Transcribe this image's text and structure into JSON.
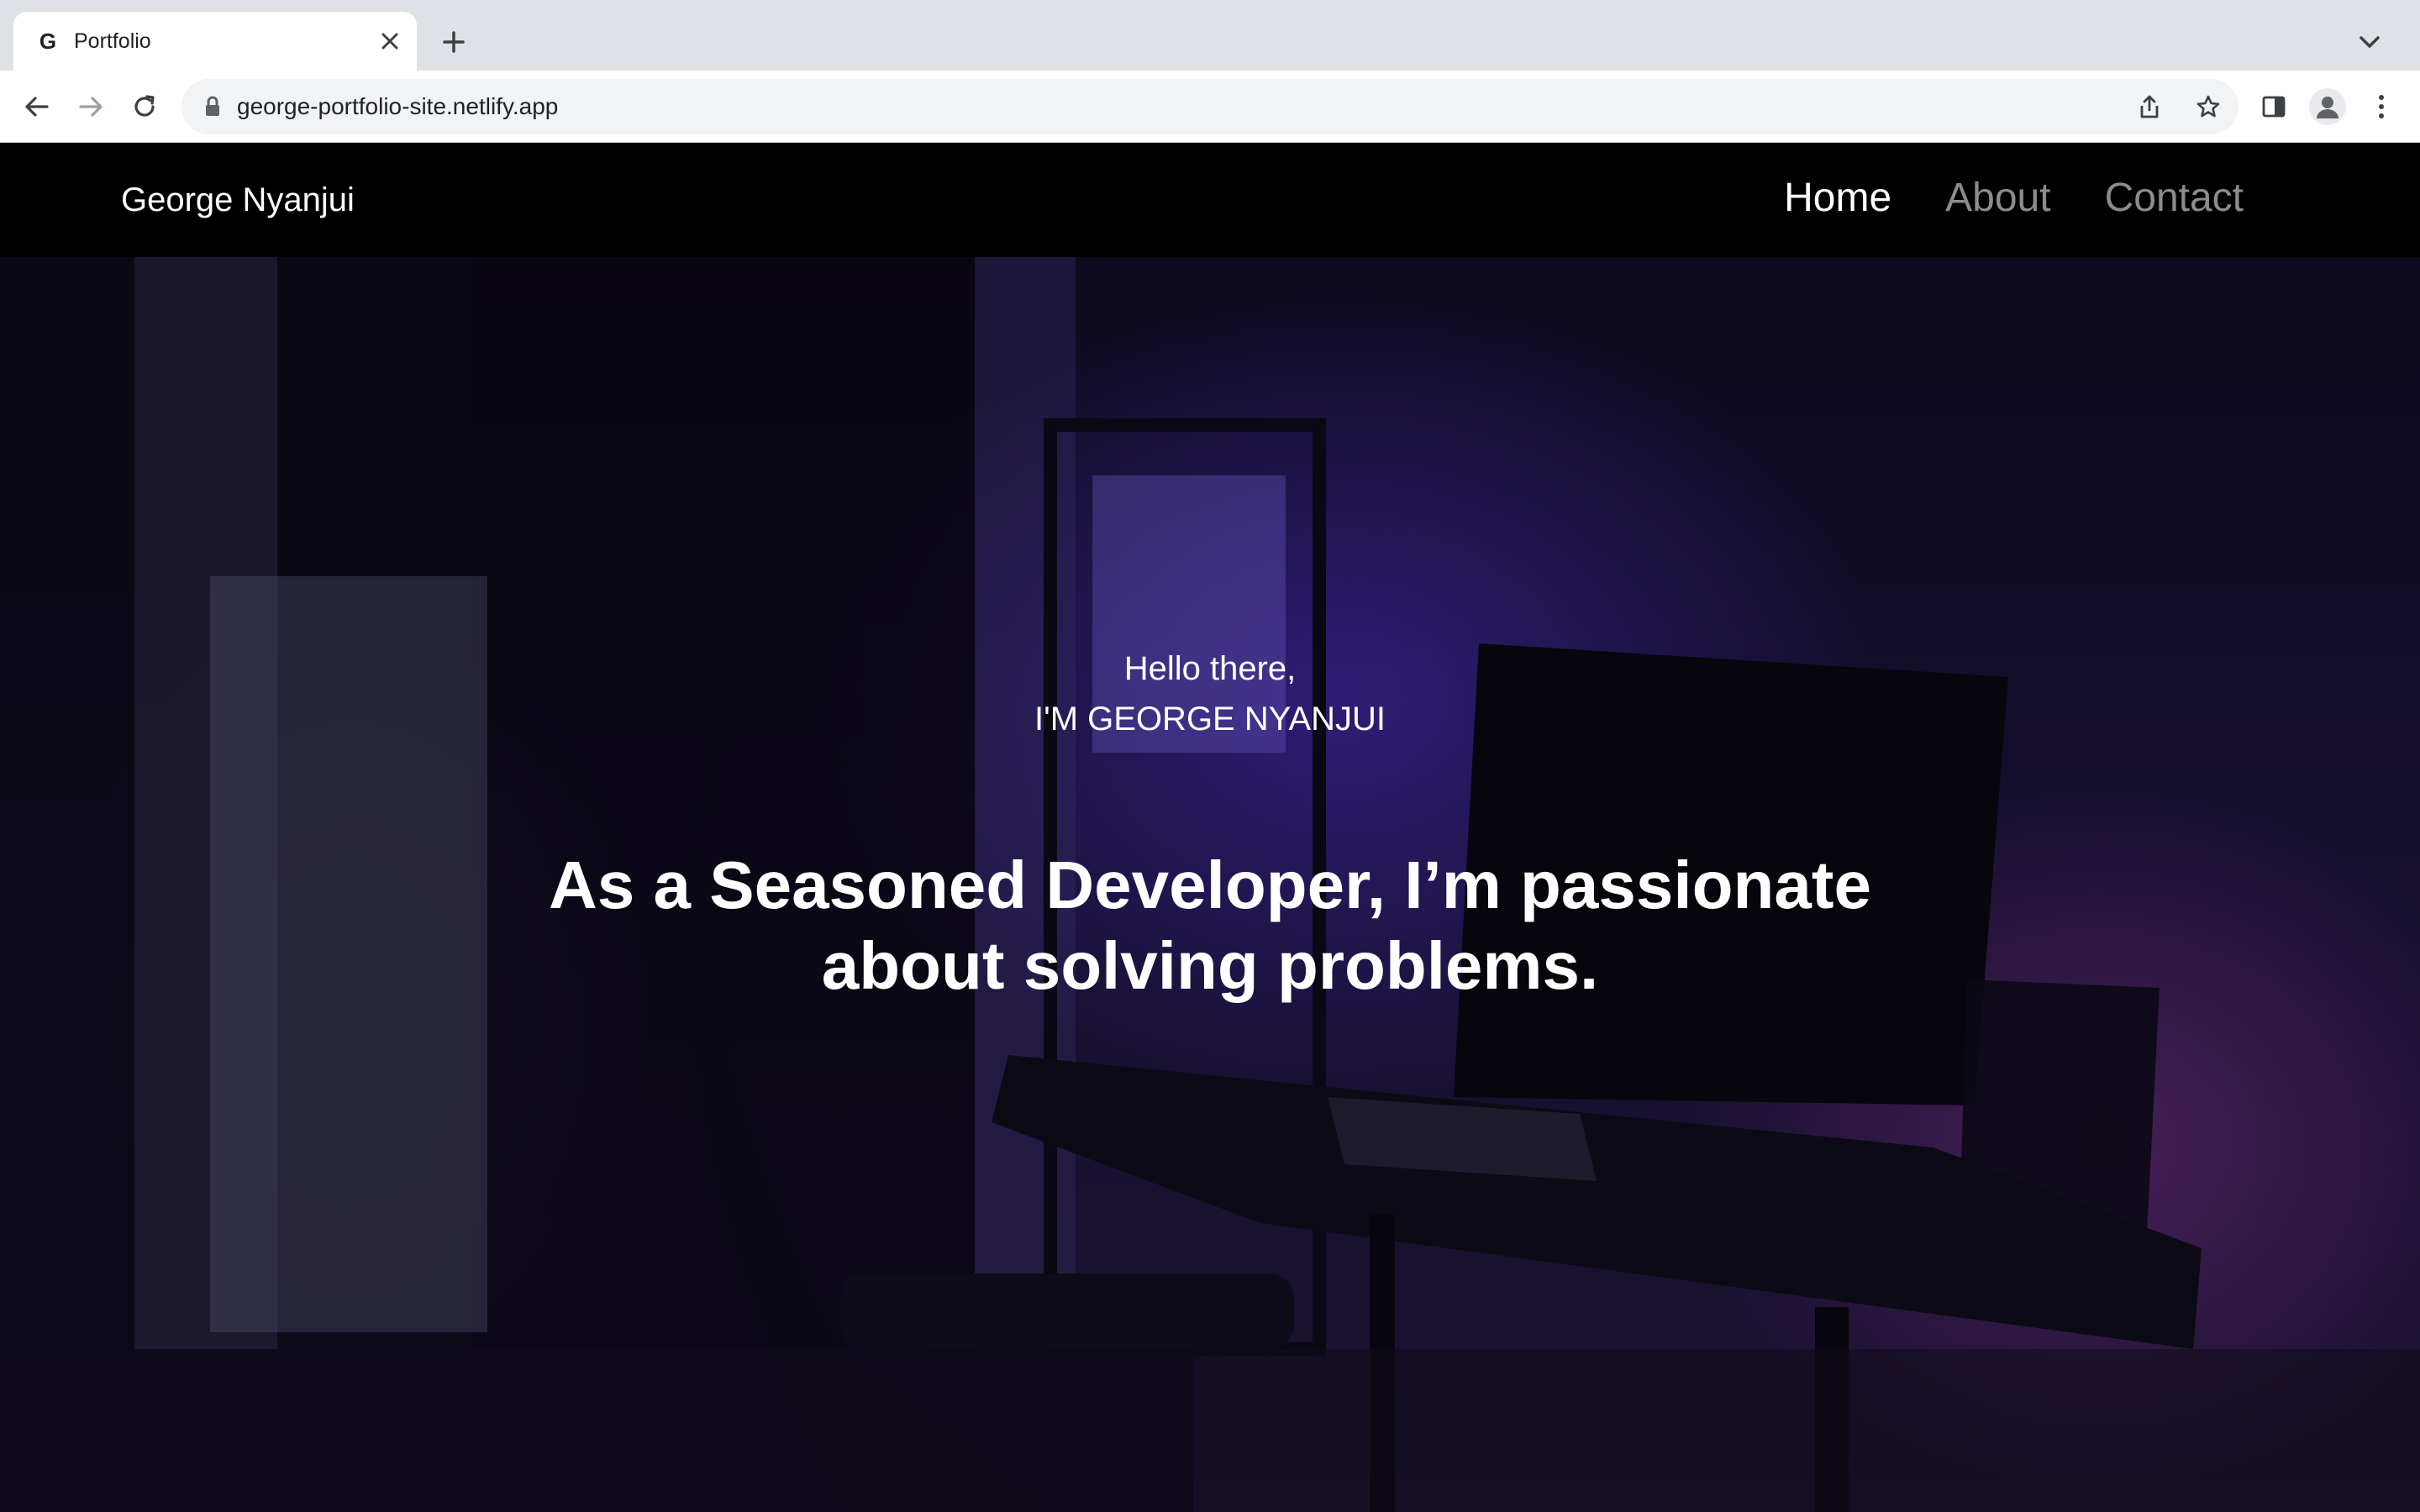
{
  "browser": {
    "tab_title": "Portfolio",
    "favicon_letter": "G",
    "url": "george-portfolio-site.netlify.app"
  },
  "site": {
    "brand": "George Nyanjui",
    "nav": [
      {
        "label": "Home",
        "active": true
      },
      {
        "label": "About",
        "active": false
      },
      {
        "label": "Contact",
        "active": false
      }
    ]
  },
  "hero": {
    "greeting_line1": "Hello there,",
    "greeting_line2": "I'M GEORGE NYANJUI",
    "headline": "As a Seasoned Developer, I’m passionate about solving problems."
  }
}
